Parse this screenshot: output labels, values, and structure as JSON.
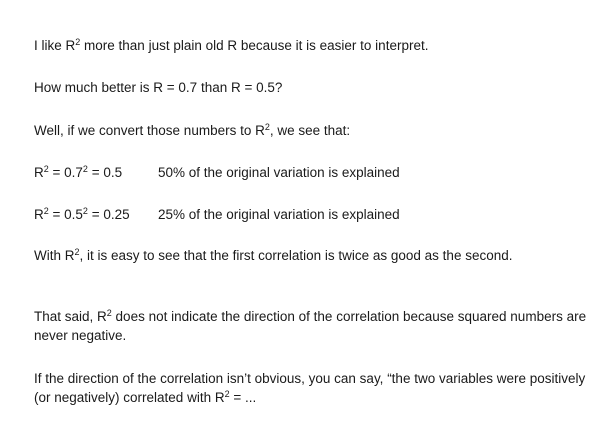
{
  "doc": {
    "intro": "I like R² more than just plain old R because it is easier to interpret.",
    "question": "How much better is R = 0.7 than R = 0.5?",
    "convert": "Well, if we convert those numbers to R², we see that:",
    "examples": [
      {
        "equation": "R² = 0.7² = 0.5",
        "explanation": "50% of the original variation is explained"
      },
      {
        "equation": "R² = 0.5² = 0.25",
        "explanation": "25% of the original variation is explained"
      }
    ],
    "comparison": "With R², it is easy to see that the first correlation is twice as good as the second.",
    "caveat": "That said, R² does not indicate the direction of the correlation because squared numbers are never negative.",
    "advice": "If the direction of the correlation isn’t obvious, you can say, “the two variables were positively (or negatively) correlated with R² = ..."
  }
}
